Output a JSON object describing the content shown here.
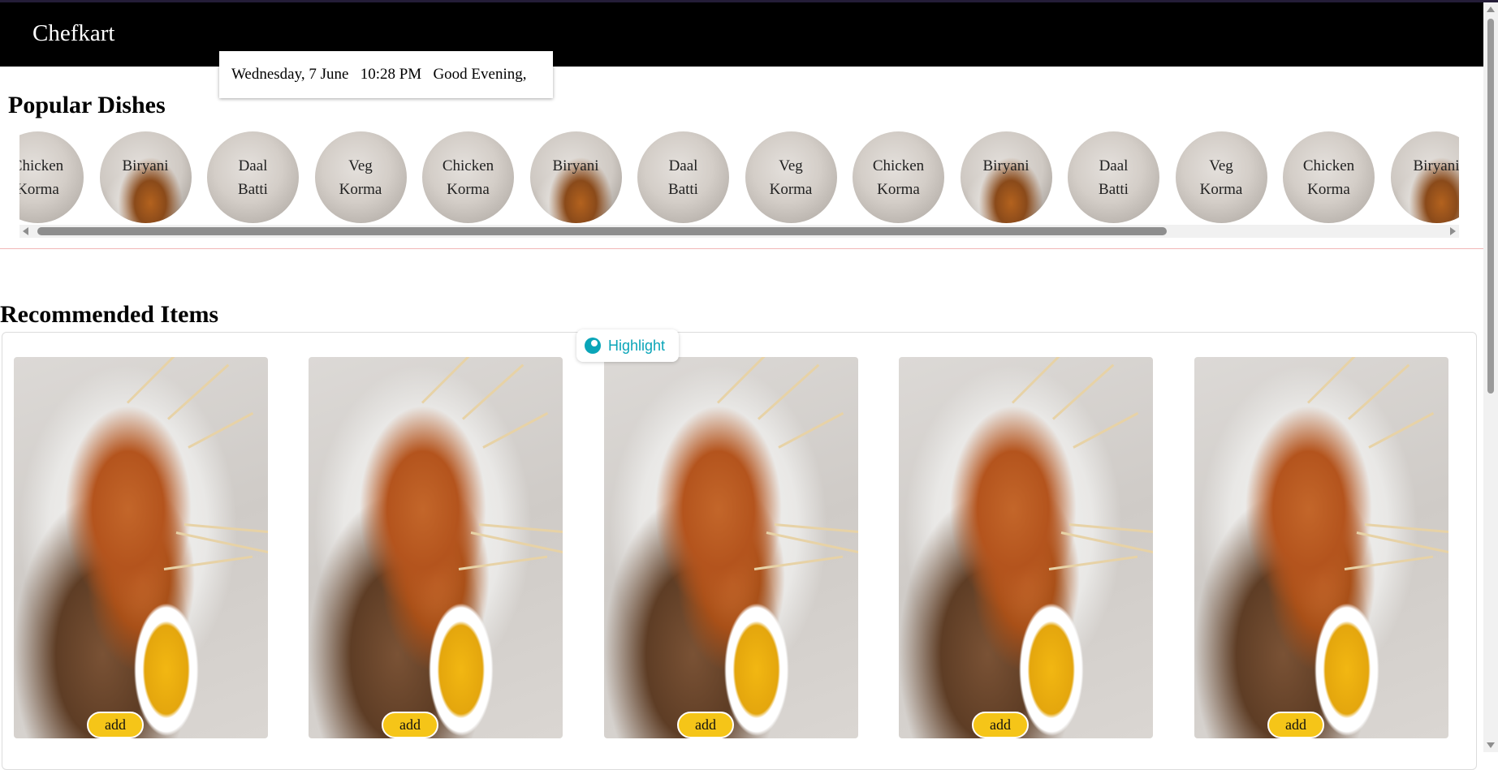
{
  "navbar": {
    "brand": "Chefkart"
  },
  "greeting": {
    "text": "Wednesday, 7 June   10:28 PM   Good Evening,"
  },
  "popular": {
    "title": "Popular Dishes",
    "dishes": [
      {
        "label": "Chicken\nKorma",
        "kind": "plain"
      },
      {
        "label": "Biryani",
        "kind": "biryani"
      },
      {
        "label": "Daal\nBatti",
        "kind": "plain"
      },
      {
        "label": "Veg\nKorma",
        "kind": "plain"
      },
      {
        "label": "Chicken\nKorma",
        "kind": "plain"
      },
      {
        "label": "Biryani",
        "kind": "biryani"
      },
      {
        "label": "Daal\nBatti",
        "kind": "plain"
      },
      {
        "label": "Veg\nKorma",
        "kind": "plain"
      },
      {
        "label": "Chicken\nKorma",
        "kind": "plain"
      },
      {
        "label": "Biryani",
        "kind": "biryani"
      },
      {
        "label": "Daal\nBatti",
        "kind": "plain"
      },
      {
        "label": "Veg\nKorma",
        "kind": "plain"
      },
      {
        "label": "Chicken\nKorma",
        "kind": "plain"
      },
      {
        "label": "Biryani",
        "kind": "biryani"
      }
    ]
  },
  "recommended": {
    "title": "Recommended Items",
    "items": [
      {
        "button": "add"
      },
      {
        "button": "add"
      },
      {
        "button": "add"
      },
      {
        "button": "add"
      },
      {
        "button": "add"
      }
    ]
  },
  "overlay": {
    "highlight_label": "Highlight",
    "icon": "highlight-icon"
  },
  "colors": {
    "navbar": "#000000",
    "add_button": "#f5c518",
    "highlight": "#0aa5b8"
  }
}
